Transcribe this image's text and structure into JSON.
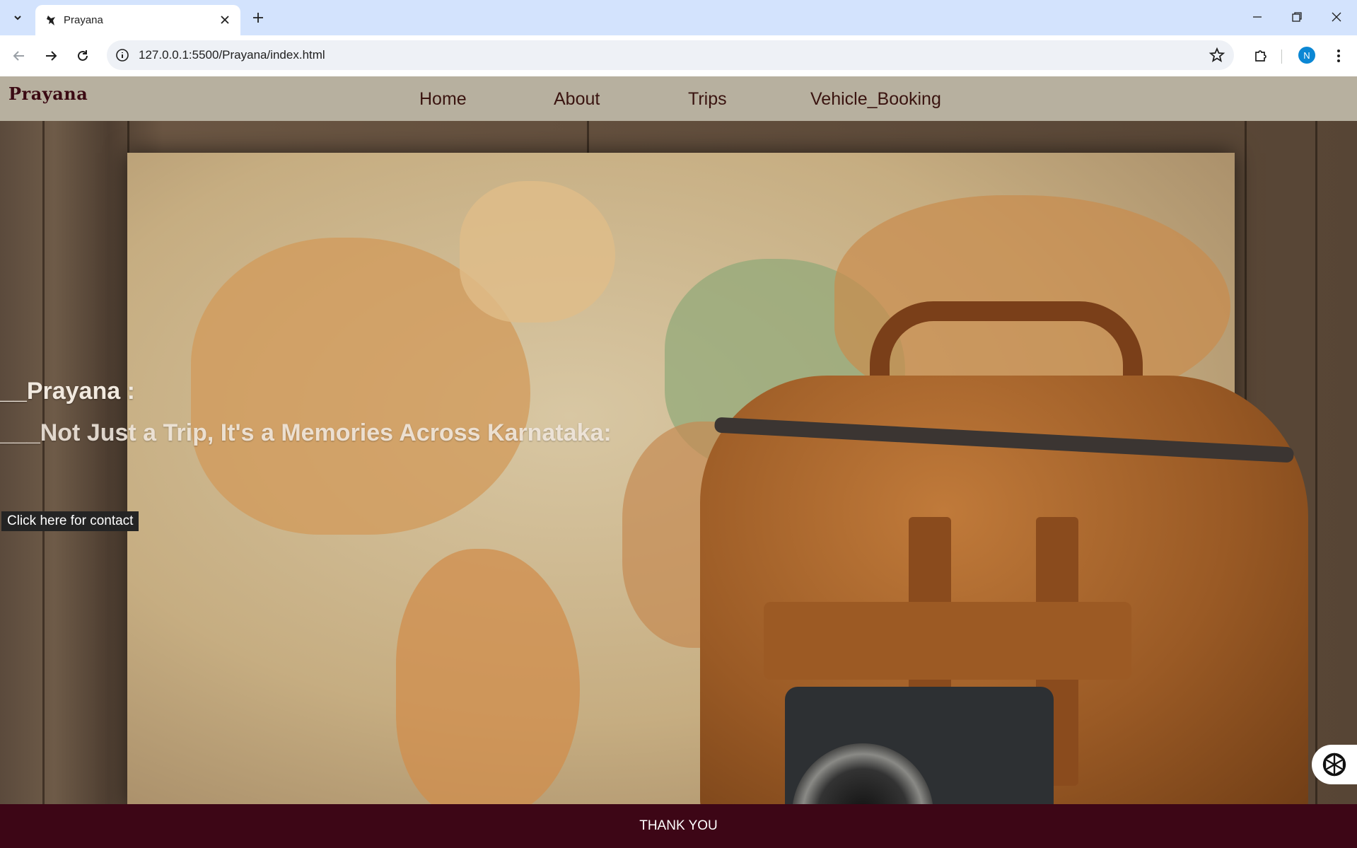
{
  "browser": {
    "tab_title": "Prayana",
    "url": "127.0.0.1:5500/Prayana/index.html",
    "profile_initial": "N"
  },
  "site": {
    "brand": "Prayana",
    "nav": [
      "Home",
      "About",
      "Trips",
      "Vehicle_Booking"
    ]
  },
  "hero": {
    "title": "__Prayana :",
    "subtitle": "___Not Just a Trip, It's a Memories Across Karnataka:",
    "contact_button": "Click here for contact"
  },
  "footer": {
    "text": "THANK YOU"
  },
  "colors": {
    "tabbar": "#d3e3fd",
    "nav_bar": "#b7b09f",
    "brand": "#3b0a13",
    "footer": "#3d0616",
    "avatar": "#0b87d4"
  },
  "icons": [
    "tab-search-icon",
    "favicon-icon",
    "close-icon",
    "plus-icon",
    "minimize-icon",
    "restore-icon",
    "close-window-icon",
    "back-icon",
    "forward-icon",
    "reload-icon",
    "site-info-icon",
    "star-icon",
    "extensions-icon",
    "kebab-menu-icon",
    "ai-assistant-icon"
  ]
}
